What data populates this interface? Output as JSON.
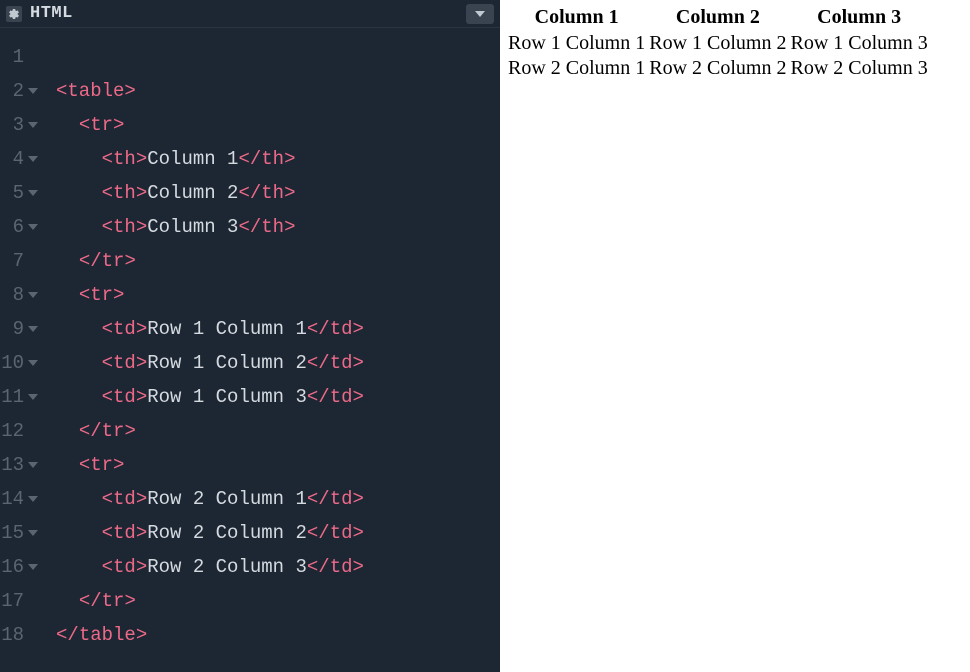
{
  "editor": {
    "title": "HTML",
    "lines": [
      {
        "num": "1",
        "fold": false,
        "html": ""
      },
      {
        "num": "2",
        "fold": true,
        "html": "<span class='tag'>&lt;</span><span class='tagname'>table</span><span class='tag'>&gt;</span>"
      },
      {
        "num": "3",
        "fold": true,
        "html": "  <span class='tag'>&lt;</span><span class='tagname'>tr</span><span class='tag'>&gt;</span>"
      },
      {
        "num": "4",
        "fold": true,
        "html": "    <span class='tag'>&lt;</span><span class='tagname'>th</span><span class='tag'>&gt;</span><span class='text'>Column 1</span><span class='tag'>&lt;/</span><span class='tagname'>th</span><span class='tag'>&gt;</span>"
      },
      {
        "num": "5",
        "fold": true,
        "html": "    <span class='tag'>&lt;</span><span class='tagname'>th</span><span class='tag'>&gt;</span><span class='text'>Column 2</span><span class='tag'>&lt;/</span><span class='tagname'>th</span><span class='tag'>&gt;</span>"
      },
      {
        "num": "6",
        "fold": true,
        "html": "    <span class='tag'>&lt;</span><span class='tagname'>th</span><span class='tag'>&gt;</span><span class='text'>Column 3</span><span class='tag'>&lt;/</span><span class='tagname'>th</span><span class='tag'>&gt;</span>"
      },
      {
        "num": "7",
        "fold": false,
        "html": "  <span class='tag'>&lt;/</span><span class='tagname'>tr</span><span class='tag'>&gt;</span>"
      },
      {
        "num": "8",
        "fold": true,
        "html": "  <span class='tag'>&lt;</span><span class='tagname'>tr</span><span class='tag'>&gt;</span>"
      },
      {
        "num": "9",
        "fold": true,
        "html": "    <span class='tag'>&lt;</span><span class='tagname'>td</span><span class='tag'>&gt;</span><span class='text'>Row 1 Column 1</span><span class='tag'>&lt;/</span><span class='tagname'>td</span><span class='tag'>&gt;</span>"
      },
      {
        "num": "10",
        "fold": true,
        "html": "    <span class='tag'>&lt;</span><span class='tagname'>td</span><span class='tag'>&gt;</span><span class='text'>Row 1 Column 2</span><span class='tag'>&lt;/</span><span class='tagname'>td</span><span class='tag'>&gt;</span>"
      },
      {
        "num": "11",
        "fold": true,
        "html": "    <span class='tag'>&lt;</span><span class='tagname'>td</span><span class='tag'>&gt;</span><span class='text'>Row 1 Column 3</span><span class='tag'>&lt;/</span><span class='tagname'>td</span><span class='tag'>&gt;</span>"
      },
      {
        "num": "12",
        "fold": false,
        "html": "  <span class='tag'>&lt;/</span><span class='tagname'>tr</span><span class='tag'>&gt;</span>"
      },
      {
        "num": "13",
        "fold": true,
        "html": "  <span class='tag'>&lt;</span><span class='tagname'>tr</span><span class='tag'>&gt;</span>"
      },
      {
        "num": "14",
        "fold": true,
        "html": "    <span class='tag'>&lt;</span><span class='tagname'>td</span><span class='tag'>&gt;</span><span class='text'>Row 2 Column 1</span><span class='tag'>&lt;/</span><span class='tagname'>td</span><span class='tag'>&gt;</span>"
      },
      {
        "num": "15",
        "fold": true,
        "html": "    <span class='tag'>&lt;</span><span class='tagname'>td</span><span class='tag'>&gt;</span><span class='text'>Row 2 Column 2</span><span class='tag'>&lt;/</span><span class='tagname'>td</span><span class='tag'>&gt;</span>"
      },
      {
        "num": "16",
        "fold": true,
        "html": "    <span class='tag'>&lt;</span><span class='tagname'>td</span><span class='tag'>&gt;</span><span class='text'>Row 2 Column 3</span><span class='tag'>&lt;/</span><span class='tagname'>td</span><span class='tag'>&gt;</span>"
      },
      {
        "num": "17",
        "fold": false,
        "html": "  <span class='tag'>&lt;/</span><span class='tagname'>tr</span><span class='tag'>&gt;</span>"
      },
      {
        "num": "18",
        "fold": false,
        "html": "<span class='tag'>&lt;/</span><span class='tagname'>table</span><span class='tag'>&gt;</span>"
      }
    ]
  },
  "preview": {
    "headers": [
      "Column 1",
      "Column 2",
      "Column 3"
    ],
    "rows": [
      [
        "Row 1 Column 1",
        "Row 1 Column 2",
        "Row 1 Column 3"
      ],
      [
        "Row 2 Column 1",
        "Row 2 Column 2",
        "Row 2 Column 3"
      ]
    ]
  }
}
